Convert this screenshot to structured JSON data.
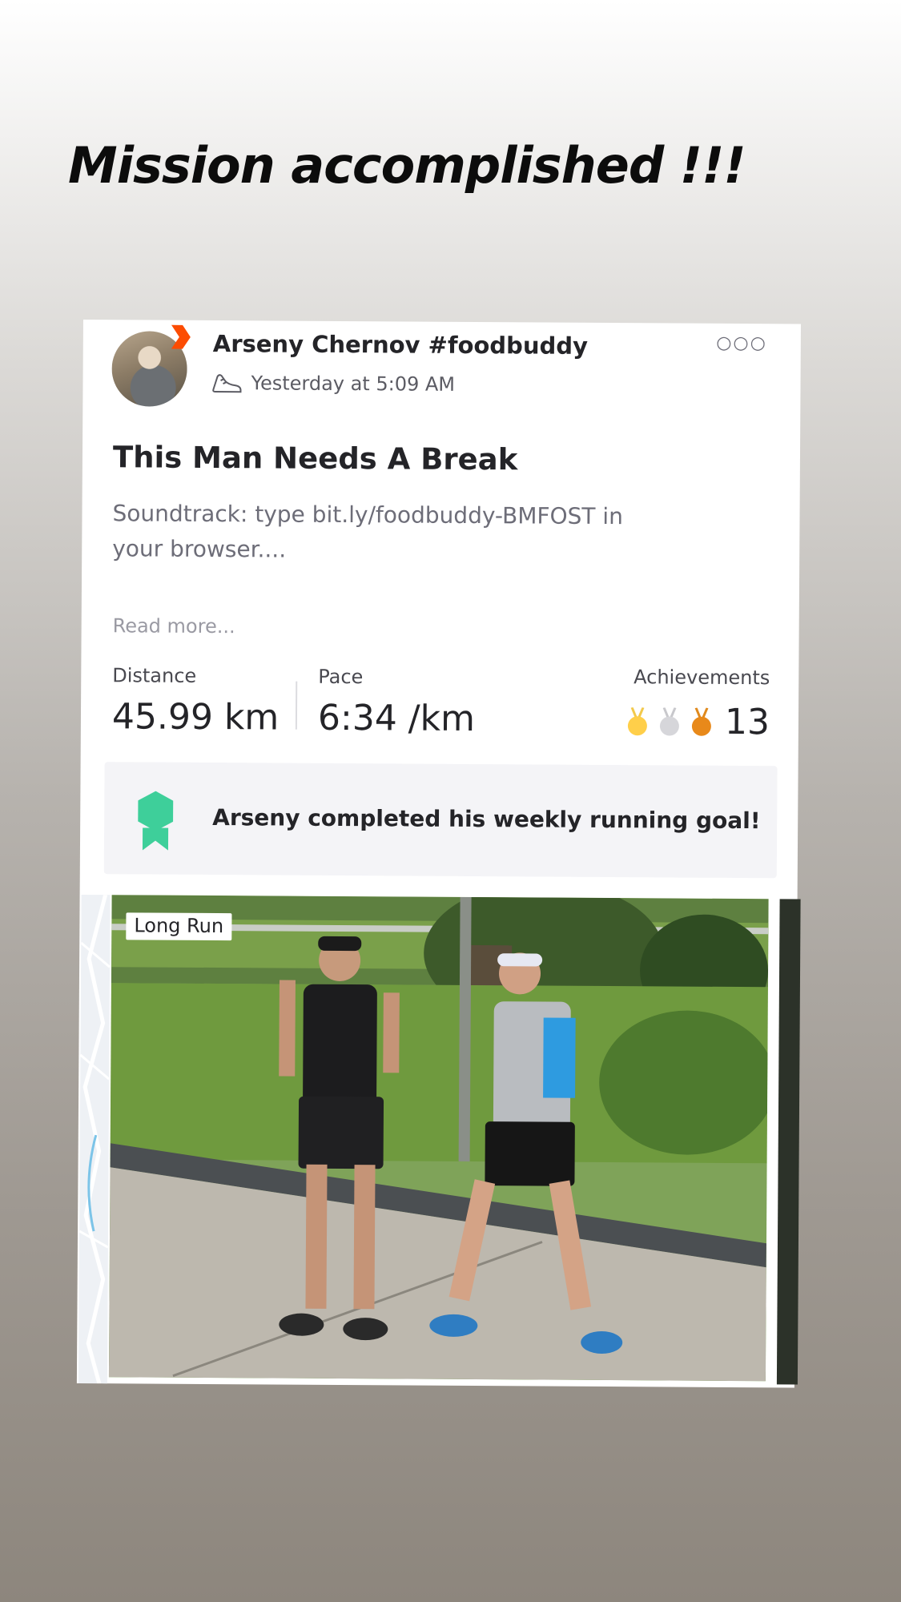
{
  "story": {
    "title": "Mission accomplished !!!"
  },
  "post": {
    "author": "Arseny Chernov #foodbuddy",
    "timestamp": "Yesterday at 5:09 AM",
    "activity_icon": "running-shoe-icon",
    "more_icon": "more-options-icon",
    "title": "This Man Needs A Break",
    "description": "Soundtrack: type bit.ly/foodbuddy-BMFOST in your browser....",
    "read_more": "Read more...",
    "brand_color": "#fc4c02"
  },
  "stats": {
    "distance": {
      "label": "Distance",
      "value": "45.99 km"
    },
    "pace": {
      "label": "Pace",
      "value": "6:34 /km"
    },
    "achievements": {
      "label": "Achievements",
      "count": "13",
      "medals": [
        "gold",
        "silver",
        "bronze"
      ]
    }
  },
  "goal": {
    "text": "Arseny completed his weekly running goal!",
    "icon": "ribbon-badge-icon",
    "color": "#3ecf9a"
  },
  "media": {
    "tag": "Long Run"
  }
}
